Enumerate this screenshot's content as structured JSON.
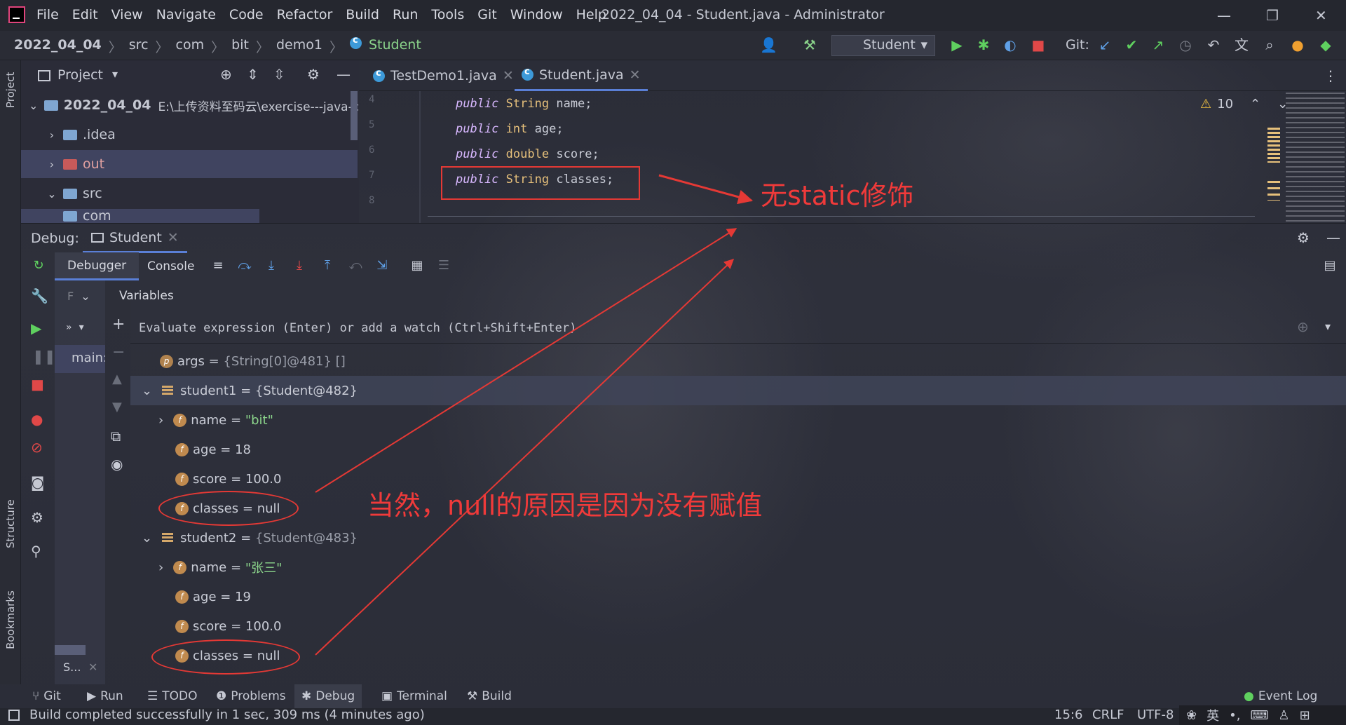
{
  "window": {
    "menus": [
      "File",
      "Edit",
      "View",
      "Navigate",
      "Code",
      "Refactor",
      "Build",
      "Run",
      "Tools",
      "Git",
      "Window",
      "Help"
    ],
    "title": "2022_04_04 - Student.java - Administrator",
    "min": "—",
    "restore": "❐",
    "close": "✕"
  },
  "nav": {
    "crumbs": [
      "2022_04_04",
      "src",
      "com",
      "bit",
      "demo1",
      "Student"
    ],
    "sep": "〉",
    "run_config": "Student",
    "git_label": "Git:"
  },
  "sidebar_left": {
    "project": "Project",
    "structure": "Structure",
    "bookmarks": "Bookmarks"
  },
  "project": {
    "title": "Project",
    "root_name": "2022_04_04",
    "root_path": "E:\\上传资料至码云\\exercise---java-cc",
    "items": [
      {
        "name": ".idea",
        "kind": "folder"
      },
      {
        "name": "out",
        "kind": "folder-red"
      },
      {
        "name": "src",
        "kind": "folder"
      },
      {
        "name": "com",
        "kind": "folder"
      }
    ]
  },
  "editor": {
    "tabs": [
      "TestDemo1.java",
      "Student.java"
    ],
    "warnings": "10",
    "lines": [
      {
        "num": "4",
        "kw": "public",
        "type": "String",
        "field": "name;"
      },
      {
        "num": "5",
        "kw": "public",
        "type": "int",
        "field": "age;"
      },
      {
        "num": "6",
        "kw": "public",
        "type": "double",
        "field": "score;"
      },
      {
        "num": "7",
        "kw": "public",
        "type": "String",
        "field": "classes;"
      },
      {
        "num": "8",
        "kw": "",
        "type": "",
        "field": ""
      }
    ]
  },
  "debug": {
    "label": "Debug:",
    "session_tab": "Student",
    "tabs": [
      "Debugger",
      "Console"
    ],
    "frames_label": "F",
    "frame": "main:",
    "frames_footer": "S...",
    "variables_label": "Variables",
    "eval_placeholder": "Evaluate expression (Enter) or add a watch (Ctrl+Shift+Enter)",
    "vars": {
      "args": {
        "icon": "p",
        "name": "args",
        "eq": "=",
        "value": "{String[0]@481} []"
      },
      "student1": {
        "name": "student1",
        "eq": "=",
        "value": "{Student@482}"
      },
      "s1_name": {
        "icon": "f",
        "name": "name",
        "eq": "=",
        "value": "\"bit\""
      },
      "s1_age": {
        "icon": "f",
        "name": "age",
        "eq": "=",
        "value": "18"
      },
      "s1_score": {
        "icon": "f",
        "name": "score",
        "eq": "=",
        "value": "100.0"
      },
      "s1_classes": {
        "icon": "f",
        "name": "classes",
        "eq": "=",
        "value": "null"
      },
      "student2": {
        "name": "student2",
        "eq": "=",
        "value": "{Student@483}"
      },
      "s2_name": {
        "icon": "f",
        "name": "name",
        "eq": "=",
        "value": "\"张三\""
      },
      "s2_age": {
        "icon": "f",
        "name": "age",
        "eq": "=",
        "value": "19"
      },
      "s2_score": {
        "icon": "f",
        "name": "score",
        "eq": "=",
        "value": "100.0"
      },
      "s2_classes": {
        "icon": "f",
        "name": "classes",
        "eq": "=",
        "value": "null"
      }
    }
  },
  "tool_tabs": [
    "Git",
    "Run",
    "TODO",
    "Problems",
    "Debug",
    "Terminal",
    "Build"
  ],
  "event_log": "Event Log",
  "status": {
    "message": "Build completed successfully in 1 sec, 309 ms (4 minutes ago)",
    "position": "15:6",
    "line_sep": "CRLF",
    "encoding": "UTF-8",
    "ime": "英"
  },
  "annotations": {
    "no_static": "无static修饰",
    "null_reason": "当然，null的原因是因为没有赋值"
  },
  "colors": {
    "accent": "#5a7fd6",
    "annotation": "#e53935",
    "string": "#8bd48b",
    "keyword": "#d8b8ff"
  }
}
